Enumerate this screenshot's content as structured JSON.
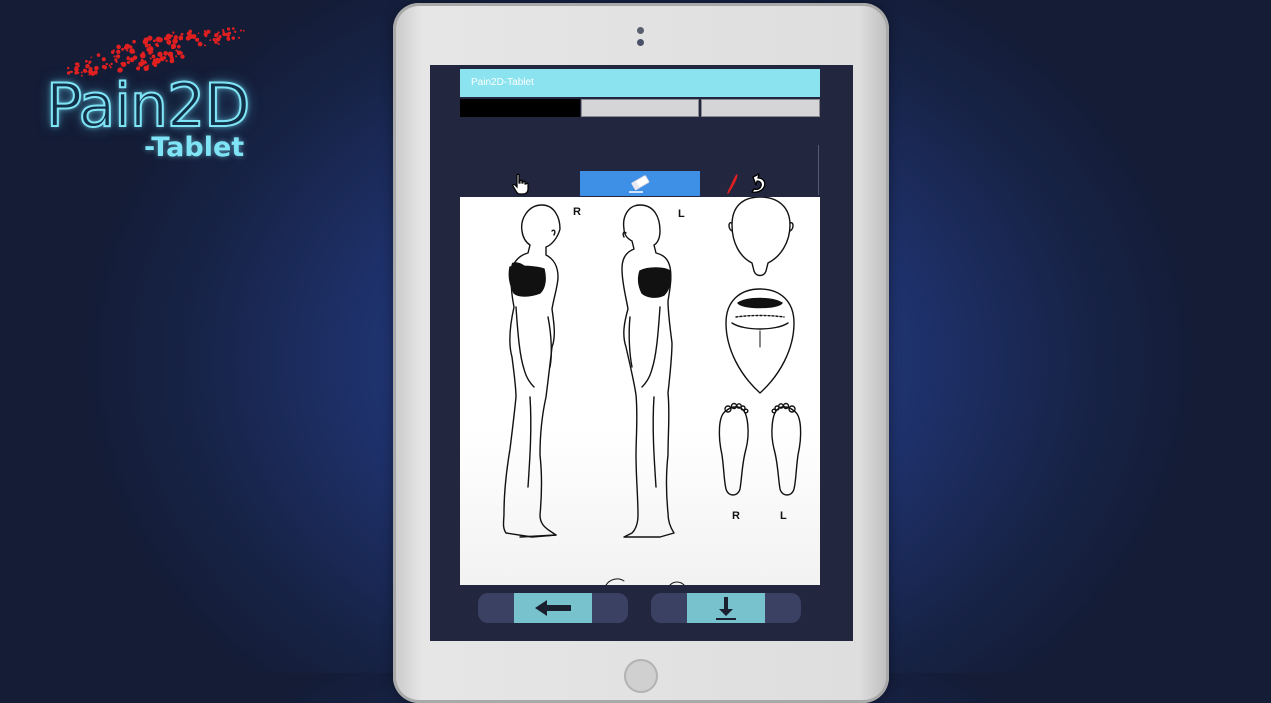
{
  "logo": {
    "main_text": "Pain2D",
    "sub_text": "-Tablet",
    "dot_color": "#e02020",
    "glow_color": "#7fe4f6"
  },
  "app": {
    "title": "Pain2D-Tablet",
    "tabs": [
      {
        "label": "",
        "selected": true
      },
      {
        "label": "",
        "selected": false
      },
      {
        "label": "",
        "selected": false
      }
    ],
    "tools": [
      {
        "icon": "hand-pointer-icon",
        "selected": false
      },
      {
        "icon": "eraser-icon",
        "selected": true
      },
      {
        "icon": "pen-icon",
        "selected": false,
        "color": "#e02020"
      },
      {
        "icon": "undo-icon",
        "selected": false
      }
    ],
    "accent_color": "#3e8fe6",
    "titlebar_color": "#8ae3ee"
  },
  "body_chart": {
    "labels": {
      "side_right": "R",
      "side_left": "L",
      "foot_right": "R",
      "foot_left": "L"
    },
    "marked_regions": [
      "right upper arm",
      "left upper arm"
    ]
  },
  "navigation": {
    "back_icon": "arrow-left-icon",
    "save_icon": "download-icon",
    "button_color": "#77c2cc"
  }
}
